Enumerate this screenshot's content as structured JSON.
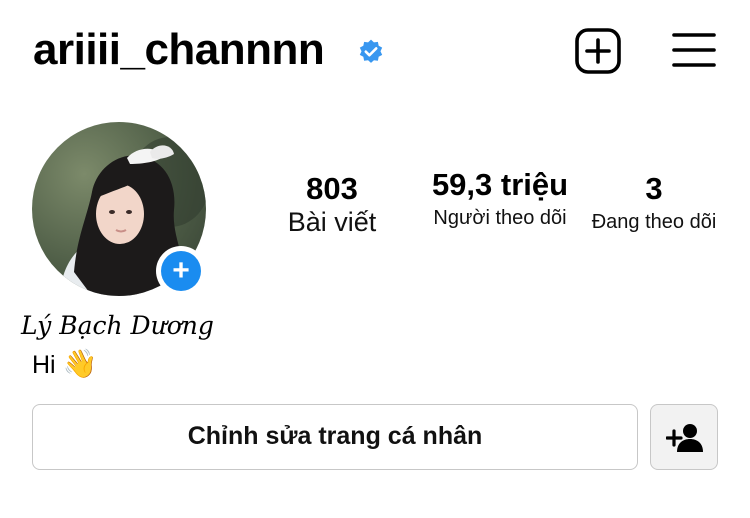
{
  "header": {
    "username": "ariiii_channnn",
    "verified_icon": "verified-badge-icon",
    "new_post_icon": "plus-square-icon",
    "menu_icon": "hamburger-menu-icon"
  },
  "profile": {
    "avatar_icon": "profile-photo",
    "add_story_symbol": "+",
    "display_name": "Lý Bạch Dương",
    "bio_text": "Hi",
    "bio_emoji": "👋"
  },
  "stats": {
    "posts": {
      "value": "803",
      "label": "Bài viết"
    },
    "followers": {
      "value": "59,3 triệu",
      "label": "Người theo dõi"
    },
    "following": {
      "value": "3",
      "label": "Đang theo dõi"
    }
  },
  "actions": {
    "edit_profile_label": "Chỉnh sửa trang cá nhân",
    "discover_people_icon": "add-person-icon"
  },
  "colors": {
    "accent_blue": "#1a8cf0",
    "verified_blue": "#3897f0",
    "button_border": "#c7c7c7"
  }
}
